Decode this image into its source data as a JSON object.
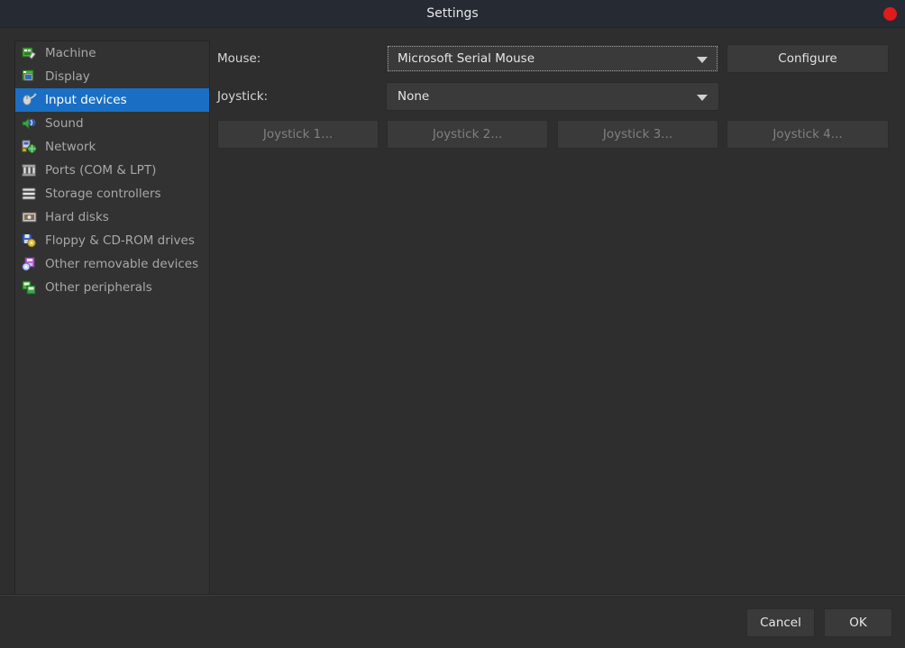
{
  "window": {
    "title": "Settings",
    "close_label": "",
    "accent_selected": "#1a6fc4",
    "close_color": "#e01b1b",
    "titlebar_color": "#252a33",
    "body_color": "#2e2e2e"
  },
  "sidebar": {
    "items": [
      {
        "label": "Machine",
        "icon": "machine-icon",
        "selected": false
      },
      {
        "label": "Display",
        "icon": "display-icon",
        "selected": false
      },
      {
        "label": "Input devices",
        "icon": "input-devices-icon",
        "selected": true
      },
      {
        "label": "Sound",
        "icon": "sound-icon",
        "selected": false
      },
      {
        "label": "Network",
        "icon": "network-icon",
        "selected": false
      },
      {
        "label": "Ports (COM & LPT)",
        "icon": "ports-icon",
        "selected": false
      },
      {
        "label": "Storage controllers",
        "icon": "storage-controllers-icon",
        "selected": false
      },
      {
        "label": "Hard disks",
        "icon": "hard-disks-icon",
        "selected": false
      },
      {
        "label": "Floppy & CD-ROM drives",
        "icon": "floppy-cdrom-icon",
        "selected": false
      },
      {
        "label": "Other removable devices",
        "icon": "other-removable-devices-icon",
        "selected": false
      },
      {
        "label": "Other peripherals",
        "icon": "other-peripherals-icon",
        "selected": false
      }
    ]
  },
  "main": {
    "mouse": {
      "label": "Mouse:",
      "value": "Microsoft Serial Mouse",
      "focused": true
    },
    "joystick": {
      "label": "Joystick:",
      "value": "None",
      "focused": false
    },
    "configure_button": "Configure",
    "joystick_buttons": [
      {
        "label": "Joystick 1...",
        "disabled": true
      },
      {
        "label": "Joystick 2...",
        "disabled": true
      },
      {
        "label": "Joystick 3...",
        "disabled": true
      },
      {
        "label": "Joystick 4...",
        "disabled": true
      }
    ]
  },
  "footer": {
    "cancel_label": "Cancel",
    "ok_label": "OK"
  }
}
